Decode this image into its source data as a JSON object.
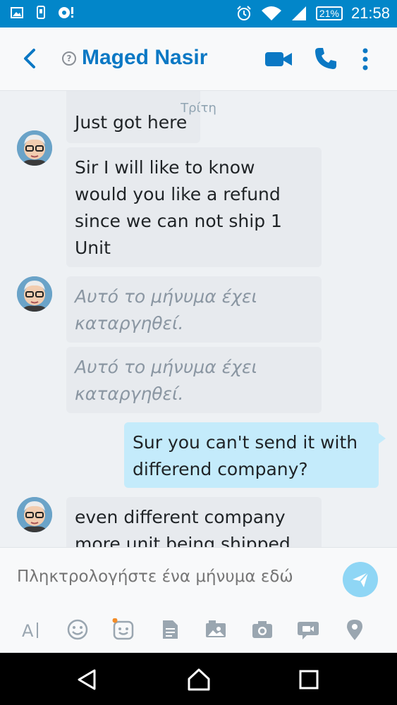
{
  "status_bar": {
    "battery": "21%",
    "time": "21:58"
  },
  "header": {
    "contact_name": "Maged Nasir"
  },
  "chat": {
    "day_label": "Τρίτη",
    "messages": [
      {
        "direction": "in",
        "text": "Just got here",
        "deleted": false
      },
      {
        "direction": "in",
        "lines": [
          "Sir I will like to know",
          "would you like a refund",
          "since we can not ship 1",
          "Unit"
        ],
        "deleted": false
      },
      {
        "direction": "in",
        "lines": [
          "Αυτό το μήνυμα έχει",
          "καταργηθεί."
        ],
        "deleted": true
      },
      {
        "direction": "in",
        "lines": [
          "Αυτό το μήνυμα έχει",
          "καταργηθεί."
        ],
        "deleted": true
      },
      {
        "direction": "out",
        "lines": [
          "Sur you can't send it with",
          "differend company?"
        ],
        "deleted": false
      },
      {
        "direction": "in",
        "lines": [
          "even different company",
          "more unit being shipped"
        ],
        "deleted": false
      }
    ]
  },
  "composer": {
    "placeholder": "Πληκτρολογήστε ένα μήνυμα εδώ"
  },
  "colors": {
    "status_bar": "#0286c9",
    "accent": "#0b78c4",
    "incoming_bubble": "#e7eaee",
    "outgoing_bubble": "#c4ebfb",
    "send_button": "#8fd6f5"
  },
  "icons": {
    "toolbar": [
      "text-format-icon",
      "emoji-icon",
      "sticker-icon",
      "file-icon",
      "media-icon",
      "camera-icon",
      "video-message-icon",
      "location-icon"
    ],
    "nav": [
      "back-triangle-icon",
      "home-icon",
      "recents-icon"
    ]
  }
}
